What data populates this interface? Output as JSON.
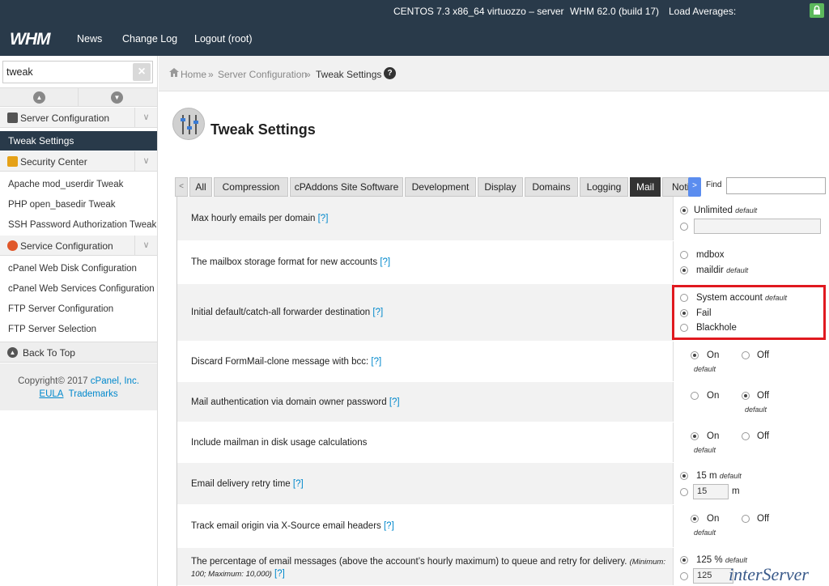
{
  "topbar": {
    "os": "CENTOS 7.3 x86_64 virtuozzo – server",
    "version": "WHM 62.0 (build 17)",
    "load": "Load Averages:"
  },
  "nav": {
    "logo": "WHM",
    "links": [
      "News",
      "Change Log",
      "Logout (root)"
    ]
  },
  "sidebar": {
    "search_value": "tweak",
    "server_config": "Server Configuration",
    "tweak_settings": "Tweak Settings",
    "security_center": "Security Center",
    "security_items": [
      "Apache mod_userdir Tweak",
      "PHP open_basedir Tweak",
      "SSH Password Authorization Tweak"
    ],
    "service_config": "Service Configuration",
    "service_items": [
      "cPanel Web Disk Configuration",
      "cPanel Web Services Configuration",
      "FTP Server Configuration",
      "FTP Server Selection"
    ],
    "back_to_top": "Back To Top",
    "copyright_prefix": "Copyright© 2017",
    "cpanel_link": "cPanel, Inc.",
    "eula": "EULA",
    "trademarks": "Trademarks"
  },
  "breadcrumb": {
    "home": "Home",
    "sep": "»",
    "section": "Server Configuration",
    "current": "Tweak Settings",
    "help": "?"
  },
  "page": {
    "title": "Tweak Settings"
  },
  "tabs": {
    "prev": "<",
    "next": ">",
    "items": [
      "All",
      "Compression",
      "cPAddons Site Software",
      "Development",
      "Display",
      "Domains",
      "Logging",
      "Mail",
      "Noti"
    ],
    "active": "Mail",
    "find_label": "Find"
  },
  "settings": {
    "help": "[?]",
    "default": "default",
    "r1": {
      "label": "Max hourly emails per domain",
      "opt1": "Unlimited"
    },
    "r2": {
      "label": "The mailbox storage format for new accounts",
      "opt1": "mdbox",
      "opt2": "maildir"
    },
    "r3": {
      "label": "Initial default/catch-all forwarder destination",
      "opt1": "System account",
      "opt2": "Fail",
      "opt3": "Blackhole"
    },
    "r4": {
      "label": "Discard FormMail-clone message with bcc:",
      "on": "On",
      "off": "Off"
    },
    "r5": {
      "label": "Mail authentication via domain owner password",
      "on": "On",
      "off": "Off"
    },
    "r6": {
      "label": "Include mailman in disk usage calculations",
      "on": "On",
      "off": "Off"
    },
    "r7": {
      "label": "Email delivery retry time",
      "opt1": "15 m",
      "value": "15",
      "unit": "m"
    },
    "r8": {
      "label": "Track email origin via X-Source email headers",
      "on": "On",
      "off": "Off"
    },
    "r9": {
      "label": "The percentage of email messages (above the account’s hourly maximum) to queue and retry for delivery.",
      "note": "(Minimum: 100; Maximum: 10,000)",
      "opt1": "125 %",
      "value": "125"
    }
  },
  "watermark": "interServer"
}
